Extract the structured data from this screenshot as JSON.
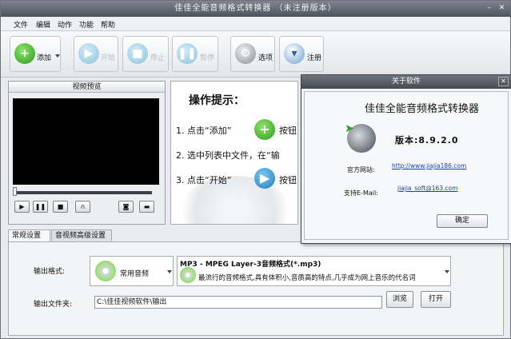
{
  "window": {
    "title": "佳佳全能音频格式转换器 （未注册版本）",
    "min_glyph": "–",
    "close_glyph": "✕"
  },
  "menu": [
    "文件",
    "编辑",
    "动作",
    "功能",
    "帮助"
  ],
  "toolbar": {
    "add": "添加",
    "start": "开始",
    "stop": "停止",
    "pause": "暂停",
    "options": "选项",
    "register": "注册"
  },
  "preview": {
    "title": "视频预览"
  },
  "hint": {
    "title": "操作提示：",
    "line1": "1. 点击“添加”",
    "line1_tail": "按钮",
    "line2": "2. 选中列表中文件，在“输",
    "line3": "3. 点击“开始”",
    "line3_tail": "按钮"
  },
  "tabs": [
    "常规设置",
    "音视频高级设置"
  ],
  "settings": {
    "output_format_label": "输出格式:",
    "category": "常用音频",
    "format_name": "MP3 - MPEG Layer-3音频格式(*.mp3)",
    "format_desc": "最流行的音频格式,具有体积小,音质高的特点,几乎成为网上音乐的代名词",
    "output_folder_label": "输出文件夹:",
    "output_folder": "C:\\佳佳视频软件\\输出",
    "browse": "浏览",
    "open": "打开"
  },
  "about": {
    "title": "关于软件",
    "app_name": "佳佳全能音频格式转换器",
    "version": "版本:8.9.2.0",
    "site_label": "官方网站:",
    "site": "http://www.jiajia186.com",
    "email_label": "支持E-Mail:",
    "email": "jiajia_soft@163.com",
    "ok": "确定"
  }
}
